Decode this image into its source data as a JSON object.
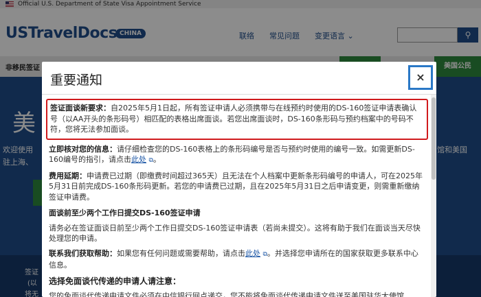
{
  "topbar": {
    "gov_text": "Official U.S. Department of State Visa Appointment Service"
  },
  "header": {
    "logo": "USTravelDocs",
    "badge": "CHINA",
    "nav": [
      "联络",
      "常见问题",
      "变更语言 ⌄"
    ],
    "search_icon": "search-icon"
  },
  "subnav": {
    "left": "非移民签证",
    "right": "美国公民"
  },
  "hero": {
    "big": "美",
    "left_text": "欢迎使用\n驻上海、",
    "right_text": "馆和美国"
  },
  "footer": {
    "lines": [
      "签证",
      "(以",
      "将无"
    ]
  },
  "modal": {
    "title": "重要通知",
    "close": "×",
    "notice": {
      "label": "签证面谈新要求：",
      "text": "自2025年5月1日起，所有签证申请人必须携带与在线预约时使用的DS-160签证申请表确认号（以AA开头的条形码号）相匹配的表格出席面谈。若您出席面谈时，DS-160条形码与预约档案中的号码不符，您将无法参加面谈。"
    },
    "verify": {
      "label": "立即核对您的信息：",
      "text": "请仔细检查您的DS-160表格上的条形码编号是否与预约时使用的编号一致。如需更新DS-160编号的指引，请点击",
      "link": "此处",
      "tail": "。"
    },
    "fee": {
      "label": "费用延期：",
      "text": "申请费已过期（即缴费时间超过365天）且无法在个人档案中更新条形码编号的申请人，可在2025年5月31日前完成DS-160条形码更新。若您的申请费已过期，且在2025年5月31日之后申请变更，则需重新缴纳签证申请费。"
    },
    "submit": {
      "heading": "面谈前至少两个工作日提交DS-160签证申请",
      "text": "请务必在签证面谈日前至少两个工作日提交DS-160签证申请表（若尚未提交）。这将有助于我们在面谈当天尽快处理您的申请。"
    },
    "contact": {
      "label": "联系我们获取帮助：",
      "text": "如果您有任何问题或需要帮助，请点击",
      "link": "此处",
      "tail": "。并选择您申请所在的国家获取更多联系中心信息。"
    },
    "waiver": {
      "heading": "选择免面谈代传递的申请人请注意：",
      "text": "您的免面谈代传递申请文件必须在中信银行网点递交，您不能将免面谈代传递申请文件送至美国驻华大使馆"
    }
  }
}
